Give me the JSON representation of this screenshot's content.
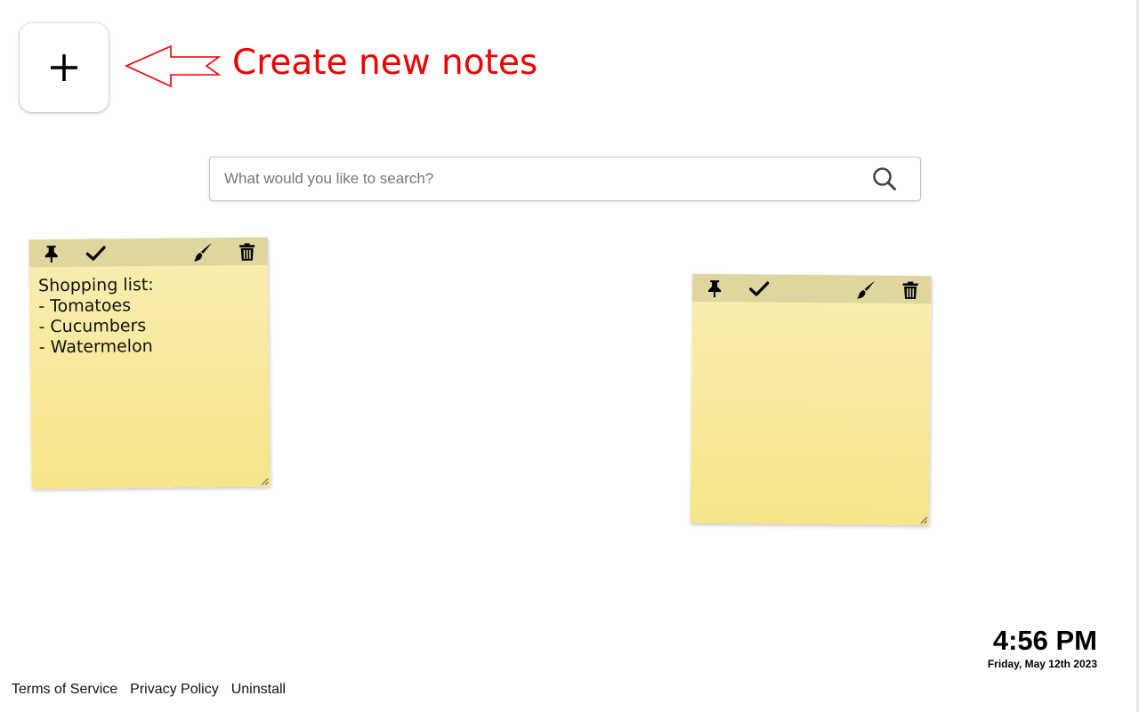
{
  "add_button": {
    "icon": "plus-icon"
  },
  "annotation": {
    "text": "Create new notes",
    "color": "#ee0000",
    "arrow": "left-arrow-outline"
  },
  "search": {
    "placeholder": "What would you like to search?",
    "value": "",
    "icon": "search-icon"
  },
  "notes": [
    {
      "tools": [
        "pin-icon",
        "check-icon",
        "brush-icon",
        "trash-icon"
      ],
      "content": "Shopping list:\n- Tomatoes\n- Cucumbers\n- Watermelon",
      "color": "#f7e99a"
    },
    {
      "tools": [
        "pin-icon",
        "check-icon",
        "brush-icon",
        "trash-icon"
      ],
      "content": "",
      "color": "#f7e99a"
    }
  ],
  "clock": {
    "time": "4:56 PM",
    "date": "Friday, May 12th 2023"
  },
  "footer": {
    "links": [
      "Terms of Service",
      "Privacy Policy",
      "Uninstall"
    ]
  }
}
